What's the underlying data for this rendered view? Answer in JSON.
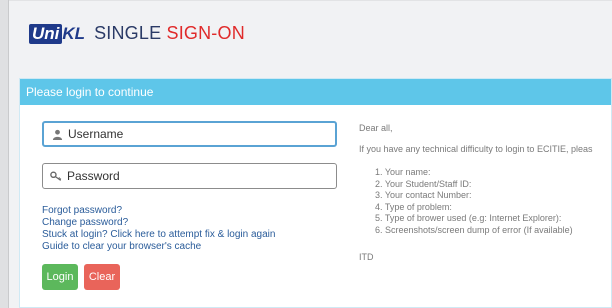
{
  "header": {
    "logo_uni": "Uni",
    "logo_kl": "KL",
    "title_part1": "SINGLE",
    "title_part2": "SIGN-ON"
  },
  "panel": {
    "heading": "Please login to continue"
  },
  "form": {
    "username_placeholder": "Username",
    "password_placeholder": "Password",
    "links": [
      "Forgot password?",
      "Change password?",
      "Stuck at login? Click here to attempt fix & login again",
      "Guide to clear your browser's cache"
    ],
    "login_label": "Login",
    "clear_label": "Clear"
  },
  "message": {
    "greeting": "Dear all,",
    "intro": "If you have any technical difficulty to login to ECITIE, pleas",
    "items": [
      "1. Your name:",
      "2. Your Student/Staff ID:",
      "3. Your contact Number:",
      "4. Type of problem:",
      "5. Type of brower used (e.g: Internet Explorer):",
      "6. Screenshots/screen dump of error (If available)"
    ],
    "signoff": "ITD"
  },
  "colors": {
    "heading_bg": "#5ec6e9",
    "login_btn": "#5cb85c",
    "clear_btn": "#e9645a",
    "brand_blue": "#1f3a8a",
    "brand_red": "#e02a2a"
  },
  "icons": {
    "username": "user-icon",
    "password": "key-icon"
  }
}
